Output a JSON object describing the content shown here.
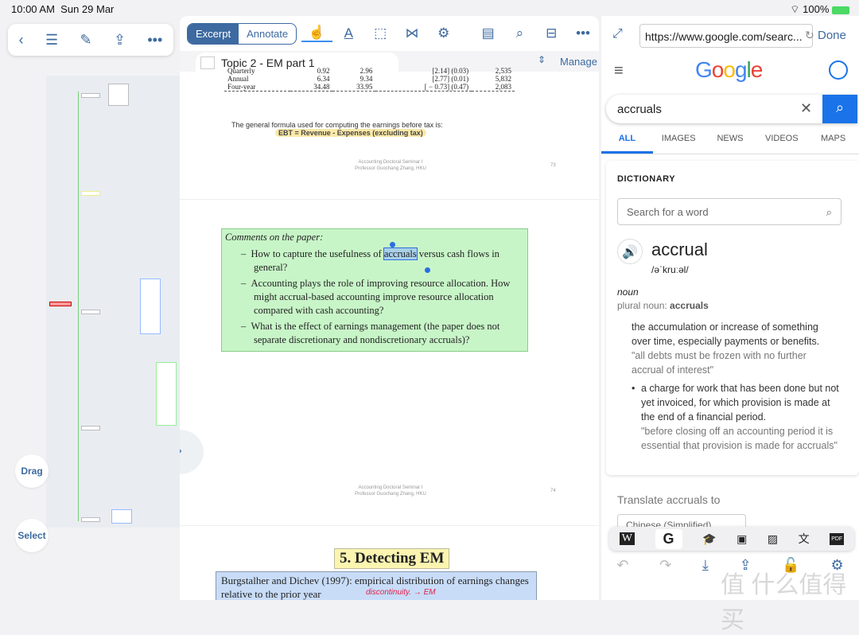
{
  "status": {
    "time": "10:00 AM",
    "date": "Sun 29 Mar",
    "battery": "100%"
  },
  "left": {
    "drag": "Drag",
    "select": "Select"
  },
  "toolbar": {
    "excerpt": "Excerpt",
    "annotate": "Annotate",
    "manage": "Manage",
    "doc_title": "Topic 2 - EM part 1"
  },
  "page73": {
    "table": [
      [
        "Quarterly",
        "0.92",
        "2.96",
        "[2.14] (0.03)",
        "2,535"
      ],
      [
        "Annual",
        "6.34",
        "9.34",
        "[2.77] (0.01)",
        "5,832"
      ],
      [
        "Four-year",
        "34.48",
        "33.95",
        "[ − 0.73] (0.47)",
        "2,083"
      ]
    ],
    "formula_intro": "The general formula used for computing the earnings before tax is:",
    "formula": "EBT = Revenue - Expenses (excluding tax)",
    "footer1": "Accounting Doctoral Seminar I",
    "footer2": "Professor Guochang Zhang, HKU",
    "num": "73"
  },
  "page74": {
    "heading": "Comments on the paper:",
    "b1a": "How to capture the usefulness of ",
    "b1sel": "accruals",
    "b1b": " versus cash flows in general?",
    "b2": "Accounting plays the role of improving resource allocation. How might accrual-based accounting improve resource allocation compared with cash accounting?",
    "b3": "What is the effect of earnings management (the paper does not separate discretionary and nondiscretionary accruals)?",
    "footer1": "Accounting Doctoral Seminar I",
    "footer2": "Professor Guochang Zhang, HKU",
    "num": "74"
  },
  "page75": {
    "title": "5. Detecting EM",
    "text": "Burgstalher and Dichev (1997): empirical distribution of earnings changes relative to the prior year",
    "handwriting": "discontinuity. → EM"
  },
  "browser": {
    "url": "https://www.google.com/searc...",
    "done": "Done",
    "logo": "Google",
    "query": "accruals",
    "tabs": [
      "ALL",
      "IMAGES",
      "NEWS",
      "VIDEOS",
      "MAPS"
    ],
    "dict": {
      "label": "DICTIONARY",
      "placeholder": "Search for a word",
      "word": "accrual",
      "phonetic": "/əˈkruːəl/",
      "pos": "noun",
      "plural_label": "plural noun: ",
      "plural": "accruals",
      "def1": "the accumulation or increase of something over time, especially payments or benefits.",
      "ex1": "\"all debts must be frozen with no further accrual of interest\"",
      "def2": "a charge for work that has been done but not yet invoiced, for which provision is made at the end of a financial period.",
      "ex2": "\"before closing off an accounting period it is essential that provision is made for accruals\""
    },
    "translate": "Translate accruals to",
    "lang": "Chinese (Simplified)"
  },
  "watermark": "值 什么值得买",
  "colors": {
    "accent": "#3d6aa0",
    "google_blue": "#1a73e8",
    "excerpt_green": "#c8f5c8",
    "highlight_blue": "#c8dcf8"
  }
}
